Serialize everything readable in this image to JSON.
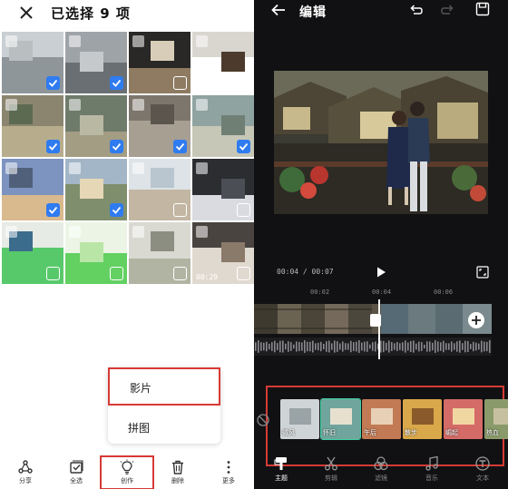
{
  "left": {
    "title": "已选择 9 项",
    "tiles": [
      {
        "checked": true,
        "video": false,
        "bg": "#c9cfd2",
        "fg": "#8f969a",
        "fg2": "#b9bec0"
      },
      {
        "checked": true,
        "video": false,
        "bg": "#9ea3a8",
        "fg": "#6a6f73",
        "fg2": "#c6c9cc"
      },
      {
        "checked": false,
        "video": false,
        "bg": "#2a2826",
        "fg": "#8e7b62",
        "fg2": "#d8cdb9"
      },
      {
        "checked": false,
        "video": false,
        "bg": "#d9d6d0",
        "fg": "#ffffff",
        "fg2": "#4c3b2c"
      },
      {
        "checked": true,
        "video": false,
        "bg": "#8b8570",
        "fg": "#b7ad8c",
        "fg2": "#5d6a52"
      },
      {
        "checked": true,
        "video": false,
        "bg": "#6e7b6a",
        "fg": "#a39d84",
        "fg2": "#b9b9a3"
      },
      {
        "checked": true,
        "video": false,
        "bg": "#7d766d",
        "fg": "#a89f93",
        "fg2": "#5b554e"
      },
      {
        "checked": true,
        "video": false,
        "bg": "#8fa3a0",
        "fg": "#c6c7b6",
        "fg2": "#6f7f74"
      },
      {
        "checked": true,
        "video": false,
        "bg": "#7d93c0",
        "fg": "#d9b98e",
        "fg2": "#51607a"
      },
      {
        "checked": true,
        "video": false,
        "bg": "#a3b6c7",
        "fg": "#7f8f6d",
        "fg2": "#e6d7b6"
      },
      {
        "checked": false,
        "video": false,
        "bg": "#dde3e7",
        "fg": "#c3b6a3",
        "fg2": "#b9c6cf"
      },
      {
        "checked": false,
        "video": false,
        "bg": "#2b2d31",
        "fg": "#d9dbe0",
        "fg2": "#4b4e55"
      },
      {
        "checked": false,
        "video": false,
        "bg": "#e6ebe5",
        "fg": "#58c96b",
        "fg2": "#3b6c8c"
      },
      {
        "checked": false,
        "video": false,
        "bg": "#ecf5e5",
        "fg": "#63d062",
        "fg2": "#b9e6a7"
      },
      {
        "checked": false,
        "video": false,
        "bg": "#d9d9d2",
        "fg": "#b1b4a2",
        "fg2": "#8b8e81"
      },
      {
        "checked": false,
        "video": true,
        "duration": "00:29",
        "bg": "#4a4440",
        "fg": "#e0d9cf",
        "fg2": "#8a7a6a"
      }
    ],
    "popup": {
      "movie_label": "影片",
      "collage_label": "拼图"
    },
    "bottom_bar": [
      {
        "label": "分享",
        "icon": "share-icon"
      },
      {
        "label": "全选",
        "icon": "select-all-icon"
      },
      {
        "label": "创作",
        "icon": "lightbulb-icon"
      },
      {
        "label": "删除",
        "icon": "trash-icon"
      },
      {
        "label": "更多",
        "icon": "more-vertical-icon"
      }
    ]
  },
  "right": {
    "title": "编辑",
    "time": "00:04 / 00:07",
    "ruler_ticks": [
      "00:02",
      "00:04",
      "00:06"
    ],
    "themes": [
      {
        "name": "微风",
        "bg": "#cfd4d6",
        "fg": "#9aa3a6"
      },
      {
        "name": "怀旧",
        "bg": "#6fa59c",
        "fg": "#e7e0cf",
        "active": true
      },
      {
        "name": "午后",
        "bg": "#c27a54",
        "fg": "#e7d0b6"
      },
      {
        "name": "散步",
        "bg": "#d9a84a",
        "fg": "#8b5a2b"
      },
      {
        "name": "崛起",
        "bg": "#d46b67",
        "fg": "#f0d6a1"
      },
      {
        "name": "热血",
        "bg": "#8a9a6a",
        "fg": "#c7c0a0"
      }
    ],
    "tabs": [
      {
        "label": "主题",
        "icon": "theme-brush-icon",
        "active": true
      },
      {
        "label": "剪辑",
        "icon": "scissors-icon"
      },
      {
        "label": "滤镜",
        "icon": "filter-icon"
      },
      {
        "label": "音乐",
        "icon": "music-note-icon"
      },
      {
        "label": "文本",
        "icon": "text-icon"
      }
    ]
  }
}
